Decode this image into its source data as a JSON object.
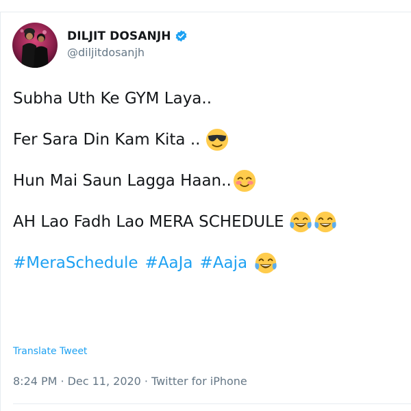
{
  "tweet": {
    "author": {
      "display_name": "DILJIT DOSANJH",
      "handle": "@diljitdosanjh",
      "verified": true
    },
    "lines": [
      {
        "text": "Subha Uth Ke GYM Laya..",
        "emoji": []
      },
      {
        "text": "Fer Sara Din Kam Kita ..",
        "emoji": [
          "smiling-face-with-sunglasses"
        ]
      },
      {
        "text": "Hun Mai Saun Lagga Haan..",
        "emoji": [
          "smiling-face-with-smiling-eyes"
        ]
      },
      {
        "text": "AH Lao Fadh Lao MERA SCHEDULE",
        "emoji": [
          "face-with-tears-of-joy",
          "face-with-tears-of-joy"
        ]
      }
    ],
    "hashtags": [
      "#MeraSchedule",
      "#AaJa",
      "#Aaja"
    ],
    "hashtags_emoji": [
      "face-with-tears-of-joy"
    ],
    "translate_label": "Translate Tweet",
    "time": "8:24 PM",
    "separator": "·",
    "date": "Dec 11, 2020",
    "source": "Twitter for iPhone"
  },
  "colors": {
    "link": "#1da1f2",
    "text": "#14171a",
    "muted": "#657786",
    "divider": "#e6ecf0",
    "emoji_yellow": "#ffcc4d"
  }
}
